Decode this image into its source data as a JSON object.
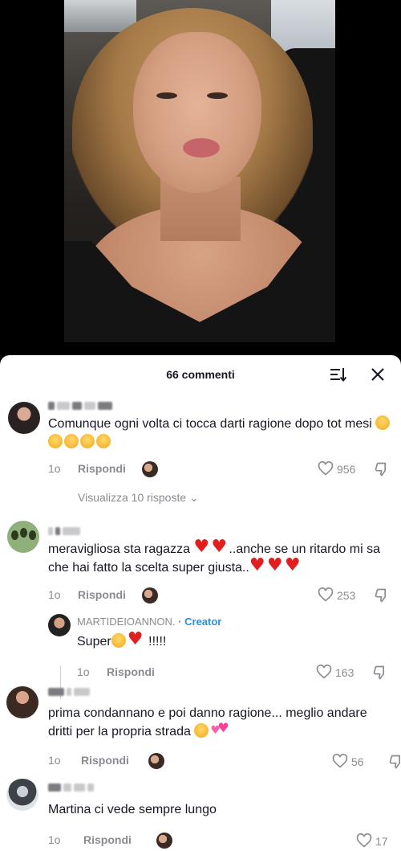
{
  "header": {
    "title": "66 commenti",
    "sort_icon": "sort-icon",
    "close_icon": "close-icon"
  },
  "comments": [
    {
      "text": "Comunque ogni volta ci tocca darti ragione dopo tot mesi",
      "emoji": [
        "laugh",
        "laugh",
        "laugh",
        "laugh",
        "laugh"
      ],
      "time": "1o",
      "reply_label": "Rispondi",
      "likes": "956",
      "view_replies": "Visualizza 10 risposte"
    },
    {
      "text_a": "meravigliosa sta ragazza",
      "text_b": "..anche se un ritardo mi sa che hai fatto la scelta super giusta..",
      "time": "1o",
      "reply_label": "Rispondi",
      "likes": "253"
    },
    {
      "username": "MARTIDEIOANNON.",
      "creator_label": "· Creator",
      "text": "Super",
      "text_end": " !!!!!",
      "time": "1o",
      "reply_label": "Rispondi",
      "likes": "163"
    },
    {
      "text": "prima condannano e poi danno ragione... meglio andare dritti per la propria strada",
      "time": "1o",
      "reply_label": "Rispondi",
      "likes": "56"
    },
    {
      "text": "Martina ci vede sempre lungo",
      "time": "1o",
      "reply_label": "Rispondi",
      "likes": "17"
    }
  ],
  "colors": {
    "creator": "#2a8fd9",
    "heart": "#e11f1f",
    "muted": "#8a8b91",
    "text": "#161823"
  }
}
